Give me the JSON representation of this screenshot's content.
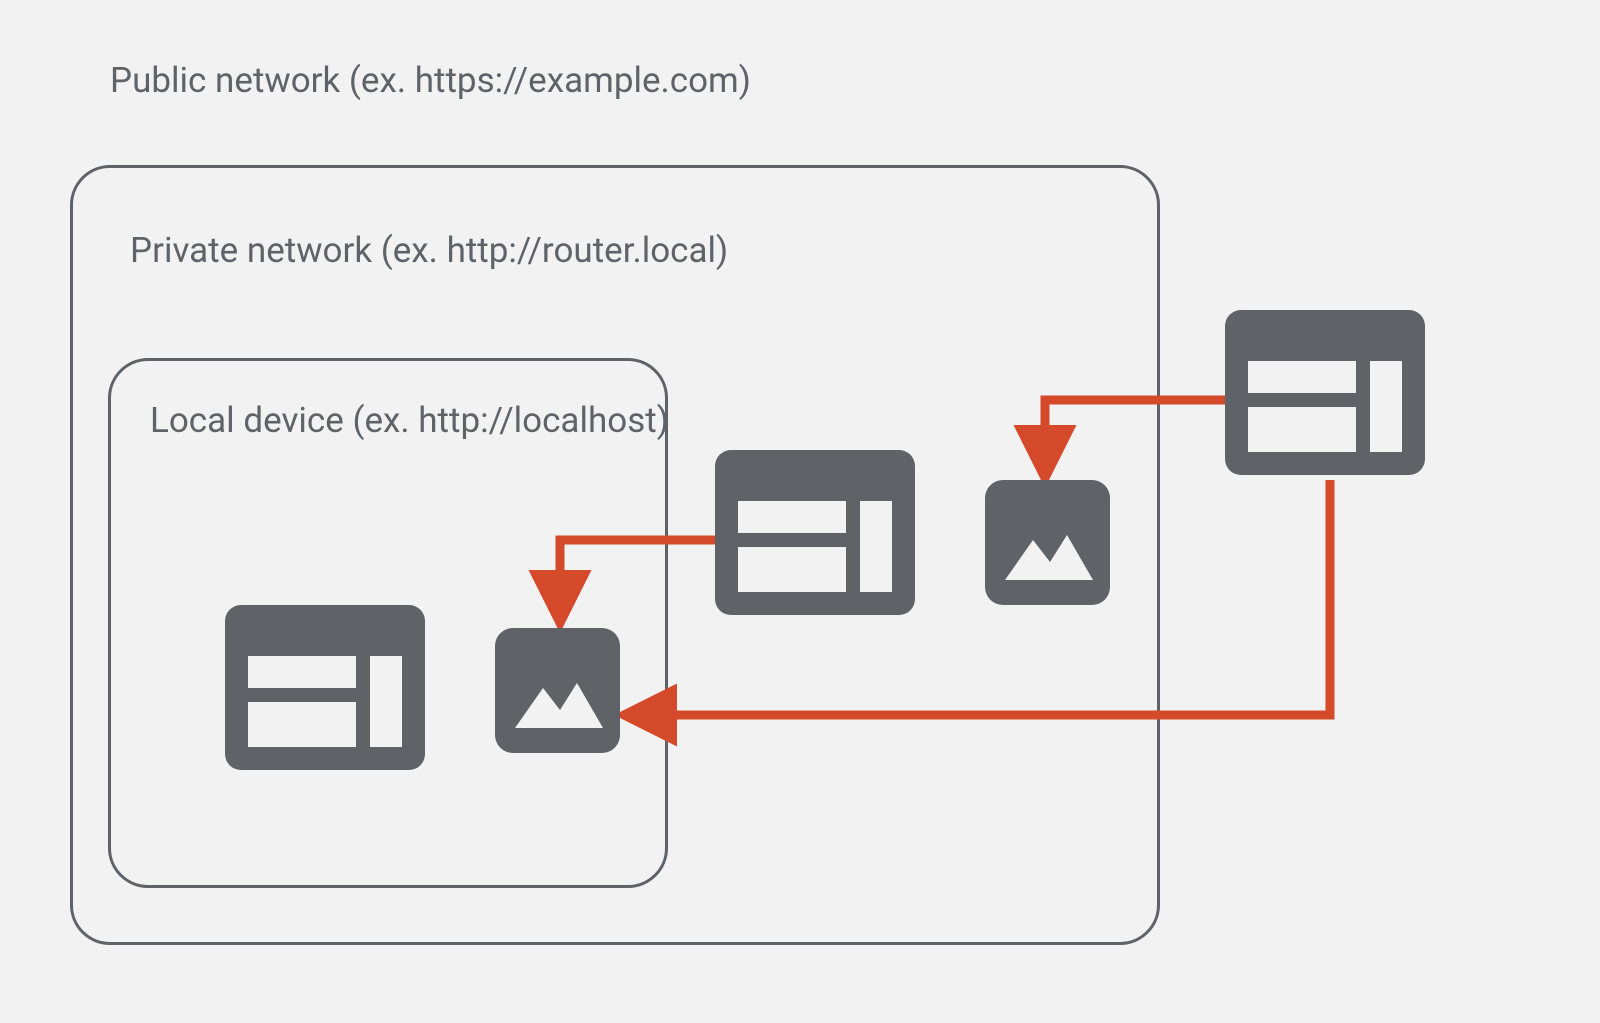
{
  "labels": {
    "public": "Public network (ex. https://example.com)",
    "private": "Private network (ex. http://router.local)",
    "local": "Local device (ex. http://localhost)"
  },
  "colors": {
    "icon_fill": "#5f6368",
    "arrow": "#d44a2b",
    "border": "#5f6368",
    "bg": "#f2f2f2"
  },
  "diagram": {
    "description": "Nested network boundaries showing public containing private containing local. Browser windows in outer layers fetch image resources from inner (more private) layers via red arrows.",
    "layers": [
      {
        "id": "public",
        "contains": [
          "private"
        ],
        "nodes": [
          "browser_public"
        ]
      },
      {
        "id": "private",
        "contains": [
          "local"
        ],
        "nodes": [
          "browser_private",
          "image_private"
        ]
      },
      {
        "id": "local",
        "contains": [],
        "nodes": [
          "browser_local",
          "image_local"
        ]
      }
    ],
    "arrows": [
      {
        "from": "browser_public",
        "to": "image_private"
      },
      {
        "from": "browser_public",
        "to": "image_local"
      },
      {
        "from": "browser_private",
        "to": "image_local"
      }
    ]
  }
}
